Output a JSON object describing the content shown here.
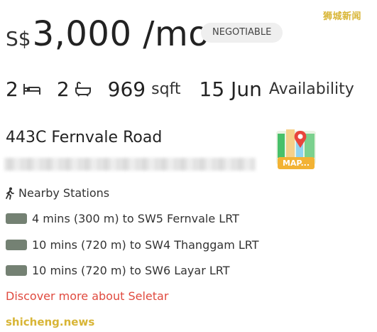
{
  "watermarks": {
    "top": "狮城新闻",
    "bottom": "shicheng.news"
  },
  "price": {
    "currency": "S$",
    "amount": "3,000 /mo",
    "badge": "NEGOTIABLE"
  },
  "specs": {
    "beds": "2",
    "baths": "2",
    "area": "969",
    "area_unit": "sqft",
    "availability_date": "15 Jun",
    "availability_label": "Availability"
  },
  "address": {
    "street": "443C Fernvale Road"
  },
  "map": {
    "label": "MAP..."
  },
  "nearby": {
    "title": "Nearby Stations",
    "stations": [
      {
        "text": "4 mins (300 m) to SW5 Fernvale LRT",
        "color": "#748173"
      },
      {
        "text": "10 mins (720 m) to SW4 Thanggam LRT",
        "color": "#748173"
      },
      {
        "text": "10 mins (720 m) to SW6 Layar LRT",
        "color": "#748173"
      }
    ]
  },
  "discover_link": "Discover more about Seletar",
  "colors": {
    "accent": "#e04a3f",
    "watermark": "#d8b536",
    "station_swatch": "#748173"
  }
}
